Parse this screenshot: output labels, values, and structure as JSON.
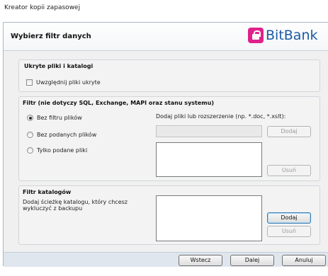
{
  "window": {
    "title": "Kreator kopii zapasowej"
  },
  "header": {
    "heading": "Wybierz filtr danych",
    "logo_text": "BitBank",
    "logo_color": "#1b5aa6",
    "logo_icon": "lock-icon",
    "logo_icon_color": "#e0218a"
  },
  "hidden_group": {
    "title": "Ukryte pliki i katalogi",
    "include_hidden_label": "Uwzględnij pliki ukryte",
    "include_hidden_checked": false
  },
  "file_filter": {
    "title": "Filtr (nie dotyczy SQL, Exchange, MAPI oraz stanu systemu)",
    "options": [
      {
        "label": "Bez filtru plików",
        "checked": true
      },
      {
        "label": "Bez podanych plików",
        "checked": false
      },
      {
        "label": "Tylko podane pliki",
        "checked": false
      }
    ],
    "extension_label": "Dodaj pliki lub rozszerzenie  (np. *.doc, *.xslt):",
    "extension_value": "",
    "add_label": "Dodaj",
    "remove_label": "Usuń"
  },
  "folder_filter": {
    "title": "Filtr katalogów",
    "description": "Dodaj ścieżkę katalogu, który chcesz wykluczyć z backupu",
    "add_label": "Dodaj",
    "remove_label": "Usuń"
  },
  "footer": {
    "back_label": "Wstecz",
    "next_label": "Dalej",
    "cancel_label": "Anuluj"
  }
}
